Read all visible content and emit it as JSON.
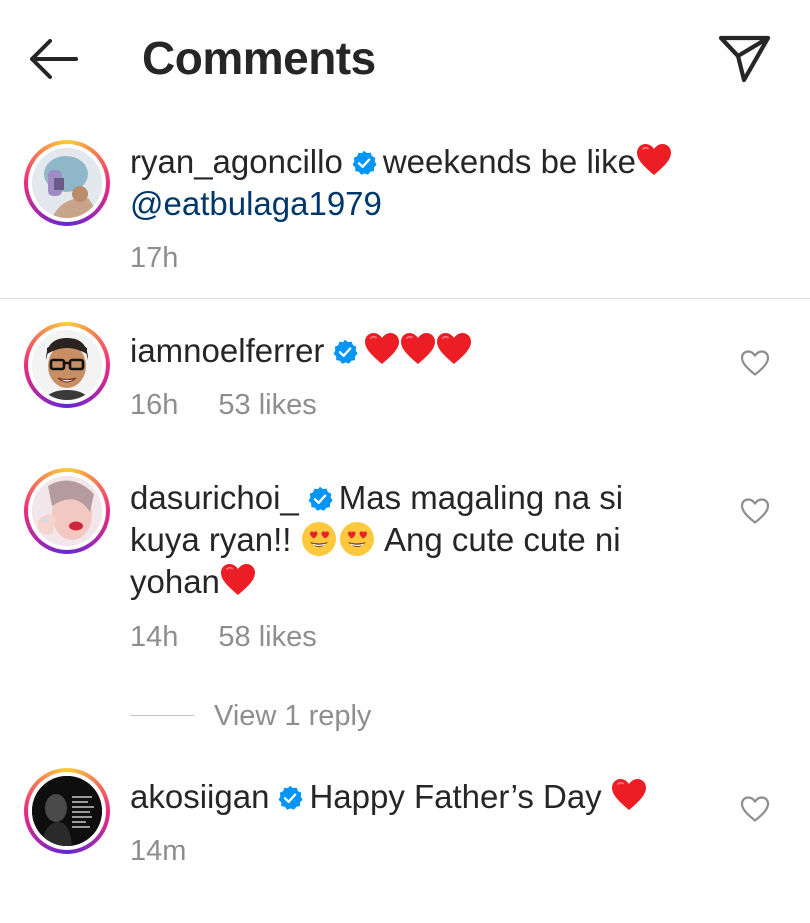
{
  "header": {
    "title": "Comments",
    "back_icon": "arrow-left-icon",
    "send_icon": "paper-plane-icon"
  },
  "caption": {
    "username": "ryan_agoncillo",
    "verified": true,
    "text": "weekends be like",
    "emoji": "red-heart",
    "mention": "@eatbulaga1979",
    "time": "17h"
  },
  "comments": [
    {
      "username": "iamnoelferrer",
      "verified": true,
      "text": "",
      "emojis": [
        "red-heart",
        "red-heart",
        "red-heart"
      ],
      "time": "16h",
      "likes": "53 likes"
    },
    {
      "username": "dasurichoi_",
      "verified": true,
      "text_part1": "Mas magaling na si",
      "text_part2": "kuya ryan!!",
      "text_part3": "Ang cute cute ni",
      "text_part4": "yohan",
      "emojis": [
        "heart-eyes-face",
        "heart-eyes-face",
        "red-heart"
      ],
      "time": "14h",
      "likes": "58 likes",
      "view_replies": "View 1 reply"
    },
    {
      "username": "akosiigan",
      "verified": true,
      "text": "Happy Father’s Day",
      "emojis": [
        "red-heart"
      ],
      "time": "14m"
    }
  ],
  "colors": {
    "text": "#262626",
    "meta": "#8e8e8e",
    "verified": "#0095f6",
    "heart": "#ed1d25",
    "mention": "#00376b",
    "divider": "#dbdbdb"
  }
}
